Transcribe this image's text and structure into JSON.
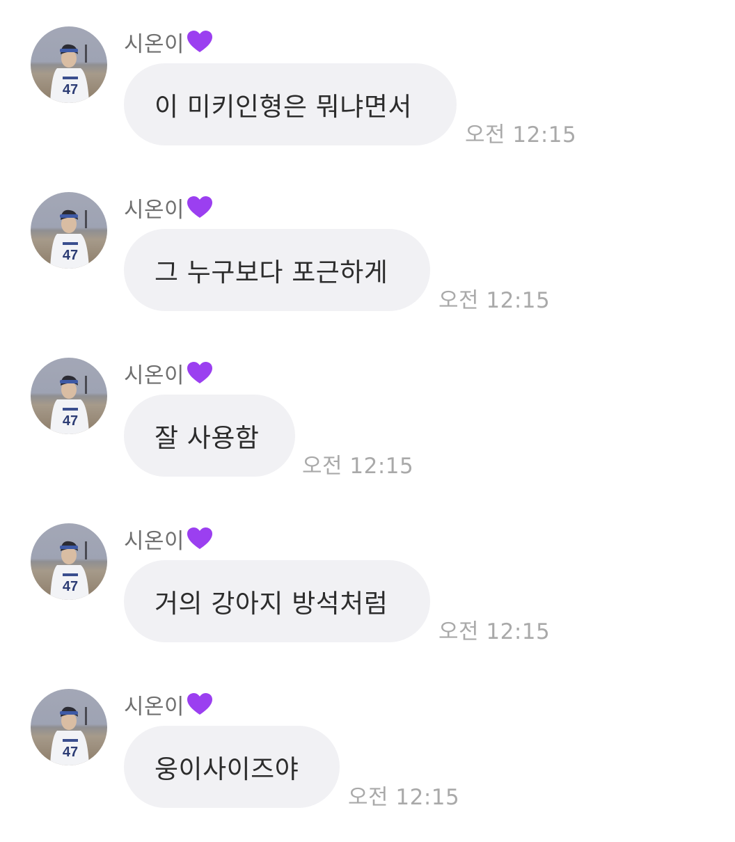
{
  "messages": [
    {
      "sender": "시온이",
      "heart_icon": "purple-heart-icon",
      "text": "이 미키인형은 뭐냐면서",
      "time": "오전 12:15"
    },
    {
      "sender": "시온이",
      "heart_icon": "purple-heart-icon",
      "text": "그 누구보다 포근하게",
      "time": "오전 12:15"
    },
    {
      "sender": "시온이",
      "heart_icon": "purple-heart-icon",
      "text": "잘 사용함",
      "time": "오전 12:15"
    },
    {
      "sender": "시온이",
      "heart_icon": "purple-heart-icon",
      "text": "거의 강아지 방석처럼",
      "time": "오전 12:15"
    },
    {
      "sender": "시온이",
      "heart_icon": "purple-heart-icon",
      "text": "웅이사이즈야",
      "time": "오전 12:15"
    }
  ],
  "colors": {
    "bubble": "#f1f1f4",
    "heart": "#9b3ff0",
    "sender": "#6f6f6f",
    "time": "#a9a9a9",
    "text": "#2c2c2c"
  }
}
